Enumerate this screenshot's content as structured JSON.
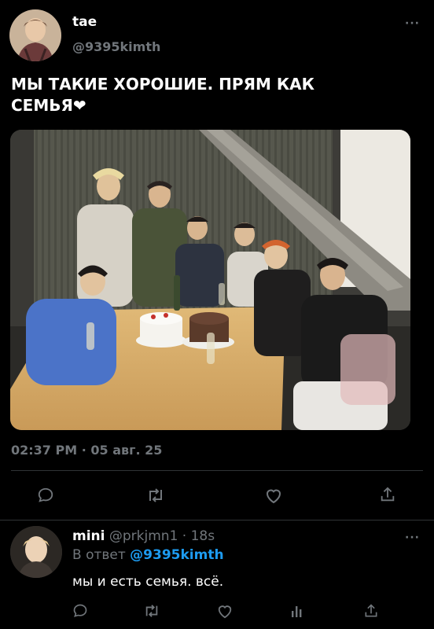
{
  "tweet": {
    "display_name": "tae",
    "handle": "@9395kimth",
    "text_line1": "МЫ ТАКИЕ ХОРОШИЕ. ПРЯМ КАК",
    "text_line2": "СЕМЬЯ",
    "heart_emoji": "❤",
    "timestamp": "02:37 PM · 05 авг. 25",
    "more": "···",
    "actions": [
      "reply-icon",
      "retweet-icon",
      "like-icon",
      "share-icon"
    ]
  },
  "reply": {
    "display_name": "mini",
    "handle": "@prkjmn1",
    "separator": "·",
    "time": "18s",
    "reply_prefix": "В ответ",
    "reply_to": "@9395kimth",
    "text": "мы и есть семья. всё.",
    "more": "···",
    "actions": [
      "reply-icon",
      "retweet-icon",
      "like-icon",
      "views-icon",
      "share-icon"
    ]
  },
  "colors": {
    "background": "#000000",
    "text": "#e7e9ea",
    "secondary": "#71767b",
    "accent": "#1d9bf0",
    "divider": "#2f3336"
  }
}
